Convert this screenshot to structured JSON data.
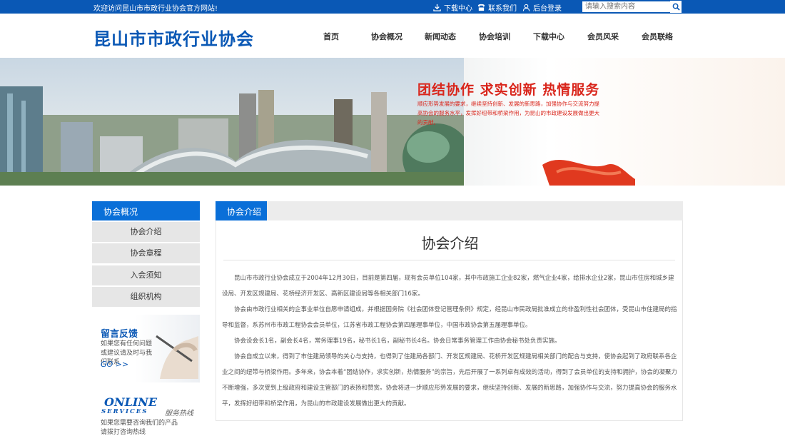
{
  "topbar": {
    "welcome": "欢迎访问昆山市市政行业协会官方网站!",
    "download": "下载中心",
    "contact": "联系我们",
    "login": "后台登录",
    "search_placeholder": "请输入搜索内容"
  },
  "header": {
    "logo": "昆山市市政行业协会",
    "nav": [
      "首页",
      "协会概况",
      "新闻动态",
      "协会培训",
      "下载中心",
      "会员风采",
      "会员联络"
    ]
  },
  "banner": {
    "slogan": "团结协作  求实创新  热情服务",
    "subslogan": "顺应形势发展的要求，继续坚持创新、发展的新思路，加强协作与交流努力提高协会的服务水平，发挥好纽带和桥梁作用，为昆山的市政建设发展做出更大的贡献。"
  },
  "sidebar": {
    "title": "协会概况",
    "items": [
      "协会介绍",
      "协会章程",
      "入会须知",
      "组织机构"
    ],
    "message": {
      "title": "留言反馈",
      "desc": "如果您有任何问题或建议请及时与我们联系",
      "go": "GO >>"
    },
    "online": {
      "line1": "ONLINE",
      "line2": "SERVICES",
      "hotline": "服务热线",
      "desc1": "如果您需要咨询我们的产品",
      "desc2": "请拨打咨询热线"
    }
  },
  "main": {
    "tab": "协会介绍",
    "title": "协会介绍",
    "paragraphs": [
      "昆山市市政行业协会成立于2004年12月30日，目前是第四届，现有会员单位104家，其中市政施工企业82家，燃气企业4家，给排水企业2家，昆山市住房和城乡建设局、开发区规建局、花桥经济开发区、高新区建设局等各相关部门16家。",
      "协会由市政行业相关的企事业单位自愿申请组成，并根据国务院《社会团体登记管理条例》规定，经昆山市民政局批准成立的非盈利性社会团体，受昆山市住建局的指导和监督，系苏州市市政工程协会会员单位，江苏省市政工程协会第四届理事单位，中国市政协会第五届理事单位。",
      "协会设会长1名，副会长4名，常务理事19名，秘书长1名，副秘书长4名。协会日常事务管理工作由协会秘书处负责实施。",
      "协会自成立以来，得到了市住建局领导的关心与支持，也得到了住建局各部门、开发区规建局、花桥开发区规建局相关部门的配合与支持，使协会起到了政府联系各企业之间的纽带与桥梁作用。多年来，协会本着“团结协作，求实创新，热情服务”的宗旨，先后开展了一系列卓有成效的活动，得到了会员单位的支持和拥护，协会的凝聚力不断增强，多次受到上级政府和建设主管部门的表扬和赞赏。协会将进一步顺应形势发展的要求，继续坚持创新、发展的新思路，加强协作与交流，努力提高协会的服务水平，发挥好纽带和桥梁作用，为昆山的市政建设发展做出更大的贡献。"
    ]
  },
  "colors": {
    "brand_blue": "#0a58b5",
    "accent_blue": "#0a6fd8",
    "slogan_red": "#d9261c"
  }
}
